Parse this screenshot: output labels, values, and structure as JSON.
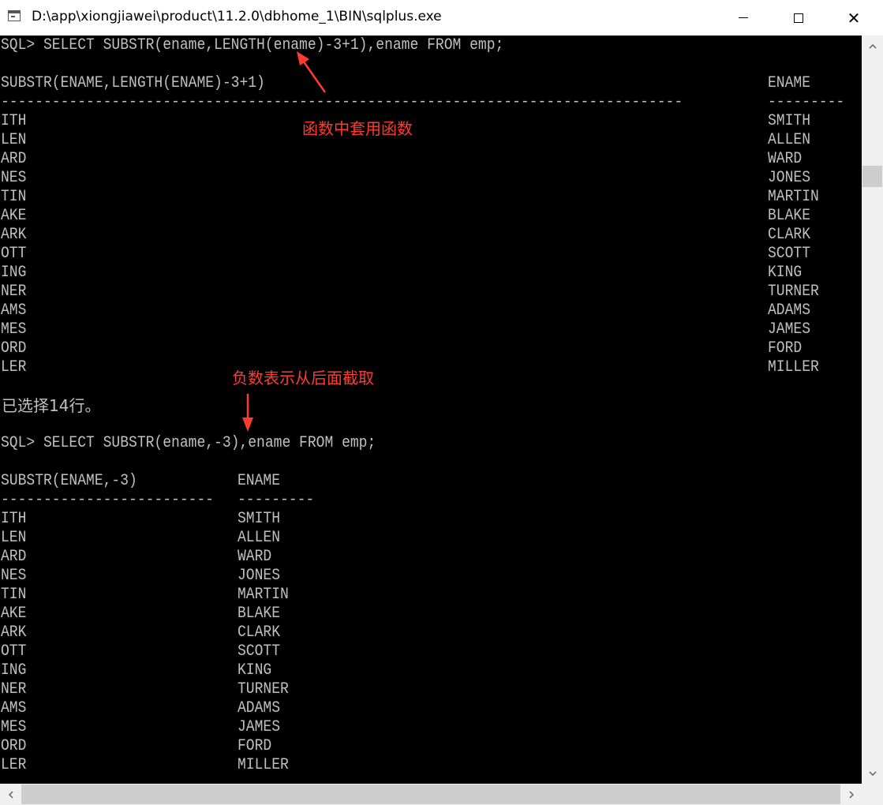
{
  "window": {
    "title": "D:\\app\\xiongjiawei\\product\\11.2.0\\dbhome_1\\BIN\\sqlplus.exe",
    "min_symbol": "",
    "close_symbol": "✕"
  },
  "query1": {
    "command": "SQL> SELECT SUBSTR(ename,LENGTH(ename)-3+1),ename FROM emp;",
    "col1_header": "SUBSTR(ENAME,LENGTH(ENAME)-3+1)",
    "col2_header": "ENAME",
    "col1_underline": "--------------------------------------------------------------------------------",
    "col2_underline": "---------",
    "rows": [
      {
        "sub": "ITH",
        "ename": "SMITH"
      },
      {
        "sub": "LEN",
        "ename": "ALLEN"
      },
      {
        "sub": "ARD",
        "ename": "WARD"
      },
      {
        "sub": "NES",
        "ename": "JONES"
      },
      {
        "sub": "TIN",
        "ename": "MARTIN"
      },
      {
        "sub": "AKE",
        "ename": "BLAKE"
      },
      {
        "sub": "ARK",
        "ename": "CLARK"
      },
      {
        "sub": "OTT",
        "ename": "SCOTT"
      },
      {
        "sub": "ING",
        "ename": "KING"
      },
      {
        "sub": "NER",
        "ename": "TURNER"
      },
      {
        "sub": "AMS",
        "ename": "ADAMS"
      },
      {
        "sub": "MES",
        "ename": "JAMES"
      },
      {
        "sub": "ORD",
        "ename": "FORD"
      },
      {
        "sub": "LER",
        "ename": "MILLER"
      }
    ],
    "footer": "已选择14行。"
  },
  "query2": {
    "command": "SQL> SELECT SUBSTR(ename,-3),ename FROM emp;",
    "col1_header": "SUBSTR(ENAME,-3)",
    "col2_header": "ENAME",
    "col1_underline": "-------------------------",
    "col2_underline": "---------",
    "rows": [
      {
        "sub": "ITH",
        "ename": "SMITH"
      },
      {
        "sub": "LEN",
        "ename": "ALLEN"
      },
      {
        "sub": "ARD",
        "ename": "WARD"
      },
      {
        "sub": "NES",
        "ename": "JONES"
      },
      {
        "sub": "TIN",
        "ename": "MARTIN"
      },
      {
        "sub": "AKE",
        "ename": "BLAKE"
      },
      {
        "sub": "ARK",
        "ename": "CLARK"
      },
      {
        "sub": "OTT",
        "ename": "SCOTT"
      },
      {
        "sub": "ING",
        "ename": "KING"
      },
      {
        "sub": "NER",
        "ename": "TURNER"
      },
      {
        "sub": "AMS",
        "ename": "ADAMS"
      },
      {
        "sub": "MES",
        "ename": "JAMES"
      },
      {
        "sub": "ORD",
        "ename": "FORD"
      },
      {
        "sub": "LER",
        "ename": "MILLER"
      }
    ]
  },
  "annotations": {
    "nested": "函数中套用函数",
    "negative": "负数表示从后面截取",
    "color": "#ff3b30"
  },
  "colors": {
    "console_bg": "#000000",
    "console_text": "#c0c0c0"
  }
}
